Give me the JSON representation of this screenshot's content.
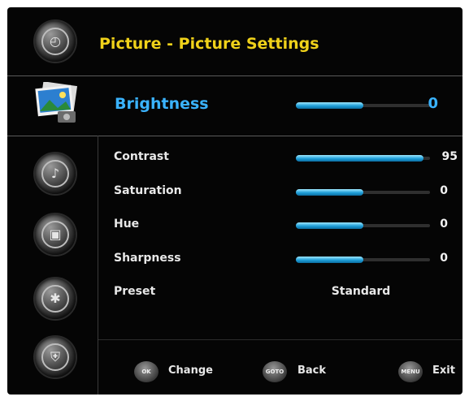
{
  "header": {
    "title": "Picture - Picture Settings"
  },
  "sidebar": {
    "icons": [
      "clock-icon",
      "picture-icon",
      "audio-icon",
      "display-icon",
      "tools-icon",
      "lock-icon"
    ]
  },
  "selected": {
    "label": "Brightness",
    "value": "0",
    "level": 0.5
  },
  "rows": [
    {
      "label": "Contrast",
      "value": "95",
      "level": 0.95
    },
    {
      "label": "Saturation",
      "value": "0",
      "level": 0.5
    },
    {
      "label": "Hue",
      "value": "0",
      "level": 0.5
    },
    {
      "label": "Sharpness",
      "value": "0",
      "level": 0.5
    }
  ],
  "preset": {
    "label": "Preset",
    "value": "Standard"
  },
  "footer": {
    "ok": {
      "key": "OK",
      "label": "Change"
    },
    "goto": {
      "key": "GOTO",
      "label": "Back"
    },
    "menu": {
      "key": "MENU",
      "label": "Exit"
    }
  },
  "colors": {
    "title": "#f0d21a",
    "selected": "#3ab3ff",
    "bar_fill": "#1f9fd9"
  }
}
